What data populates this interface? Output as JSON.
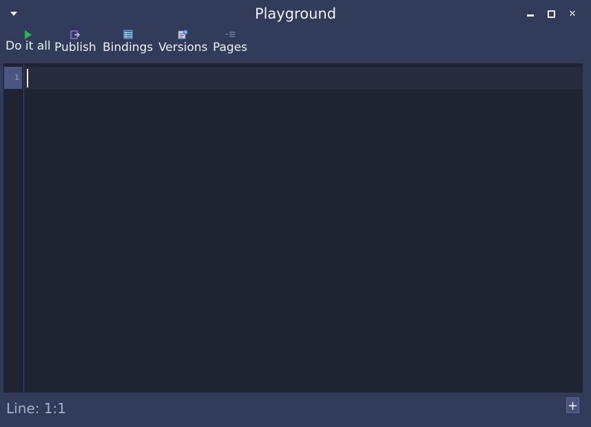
{
  "window": {
    "title": "Playground"
  },
  "toolbar": {
    "items": [
      {
        "label": "Do it all",
        "icon": "play-icon"
      },
      {
        "label": "Publish",
        "icon": "publish-icon"
      },
      {
        "label": "Bindings",
        "icon": "bindings-icon"
      },
      {
        "label": "Versions",
        "icon": "versions-icon"
      },
      {
        "label": "Pages",
        "icon": "pages-icon"
      }
    ]
  },
  "editor": {
    "line_numbers": [
      "1"
    ],
    "content": ""
  },
  "status": {
    "position": "Line: 1:1",
    "add_label": "+"
  },
  "colors": {
    "chrome": "#323c5a",
    "editor_bg": "#1f2433",
    "play_green": "#2fb35a",
    "publish_purple": "#8b6cc8",
    "bindings_blue": "#6aa7d8",
    "versions_blue": "#4f8fd0"
  }
}
